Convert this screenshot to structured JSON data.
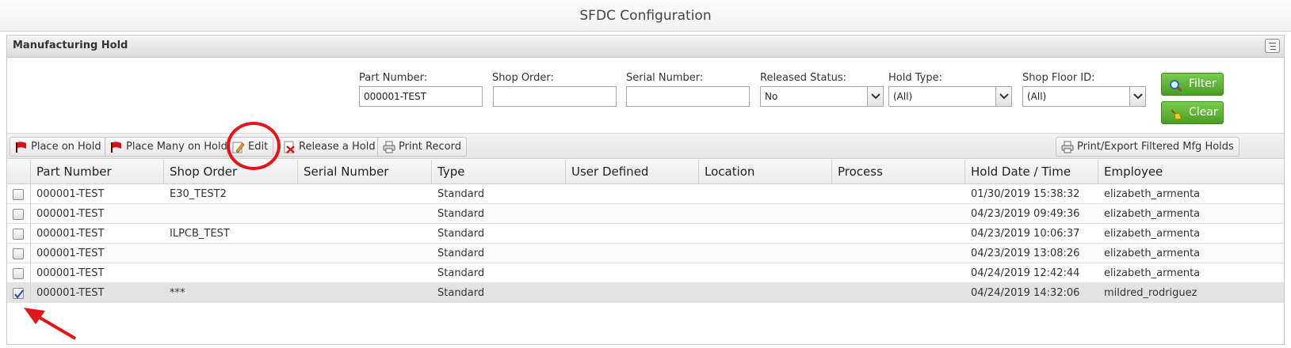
{
  "app": {
    "title": "SFDC Configuration"
  },
  "panel": {
    "title": "Manufacturing Hold",
    "tool_icon": "panel-options-icon"
  },
  "filters": {
    "part_number": {
      "label": "Part Number:",
      "value": "000001-TEST"
    },
    "shop_order": {
      "label": "Shop Order:",
      "value": ""
    },
    "serial_number": {
      "label": "Serial Number:",
      "value": ""
    },
    "released_status": {
      "label": "Released Status:",
      "value": "No"
    },
    "hold_type": {
      "label": "Hold Type:",
      "value": "(All)"
    },
    "shop_floor_id": {
      "label": "Shop Floor ID:",
      "value": "(All)"
    },
    "filter_button": "Filter",
    "clear_button": "Clear"
  },
  "toolbar": {
    "place_on_hold": "Place on Hold",
    "place_many_on_hold": "Place Many on Hold",
    "edit": "Edit",
    "release_a_hold": "Release a Hold",
    "print_record": "Print Record",
    "print_export": "Print/Export Filtered Mfg Holds"
  },
  "grid": {
    "columns": [
      "Part Number",
      "Shop Order",
      "Serial Number",
      "Type",
      "User Defined",
      "Location",
      "Process",
      "Hold Date / Time",
      "Employee"
    ],
    "rows": [
      {
        "checked": false,
        "cells": [
          "000001-TEST",
          "E30_TEST2",
          "",
          "Standard",
          "",
          "",
          "",
          "01/30/2019 15:38:32",
          "elizabeth_armenta"
        ]
      },
      {
        "checked": false,
        "cells": [
          "000001-TEST",
          "",
          "",
          "Standard",
          "",
          "",
          "",
          "04/23/2019 09:49:36",
          "elizabeth_armenta"
        ]
      },
      {
        "checked": false,
        "cells": [
          "000001-TEST",
          "ILPCB_TEST",
          "",
          "Standard",
          "",
          "",
          "",
          "04/23/2019 10:06:37",
          "elizabeth_armenta"
        ]
      },
      {
        "checked": false,
        "cells": [
          "000001-TEST",
          "",
          "",
          "Standard",
          "",
          "",
          "",
          "04/23/2019 13:08:26",
          "elizabeth_armenta"
        ]
      },
      {
        "checked": false,
        "cells": [
          "000001-TEST",
          "",
          "",
          "Standard",
          "",
          "",
          "",
          "04/24/2019 12:42:44",
          "elizabeth_armenta"
        ]
      },
      {
        "checked": true,
        "cells": [
          "000001-TEST",
          "***",
          "",
          "Standard",
          "",
          "",
          "",
          "04/24/2019 14:32:06",
          "mildred_rodriguez"
        ]
      }
    ]
  },
  "colors": {
    "accent_green": "#4a9e24",
    "annotation_red": "#e4141b",
    "selected_row": "#e3e3e3"
  }
}
